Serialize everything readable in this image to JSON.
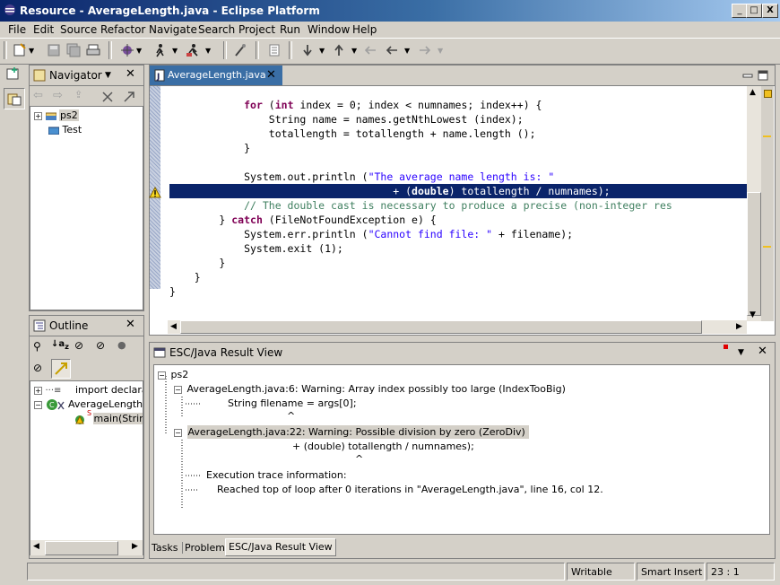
{
  "window": {
    "title": "Resource - AverageLength.java - Eclipse Platform",
    "controls": [
      "_",
      "□",
      "X"
    ]
  },
  "menu": [
    "File",
    "Edit",
    "Source",
    "Refactor",
    "Navigate",
    "Search",
    "Project",
    "Run",
    "Window",
    "Help"
  ],
  "navigator": {
    "title": "Navigator",
    "items": [
      "ps2",
      "Test"
    ]
  },
  "outline": {
    "title": "Outline",
    "items": [
      "import declarati",
      "AverageLength",
      "main(Strin"
    ],
    "static_marker": "S"
  },
  "editor": {
    "tab_label": "AverageLength.java",
    "lines": [
      [
        [
          "",
          "            "
        ],
        [
          "kw",
          "for"
        ],
        [
          "",
          " ("
        ],
        [
          "kw",
          "int"
        ],
        [
          "",
          " index = 0; index < numnames; index++) {"
        ]
      ],
      [
        [
          "",
          "                String name = names.getNthLowest (index);"
        ]
      ],
      [
        [
          "",
          "                totallength = totallength + name.length ();"
        ]
      ],
      [
        [
          "",
          "            }"
        ]
      ],
      [
        [
          "",
          ""
        ]
      ],
      [
        [
          "",
          "            System.out.println ("
        ],
        [
          "str",
          "\"The average name length is: \""
        ]
      ],
      [
        [
          "",
          "                                    + ("
        ],
        [
          "kw",
          "double"
        ],
        [
          "",
          ") totallength / numnames);"
        ]
      ],
      [
        [
          "",
          "            "
        ],
        [
          "cm",
          "// The double cast is necessary to produce a precise (non-integer res"
        ]
      ],
      [
        [
          "",
          "        } "
        ],
        [
          "kw",
          "catch"
        ],
        [
          "",
          " (FileNotFoundException e) {"
        ]
      ],
      [
        [
          "",
          "            System.err.println ("
        ],
        [
          "str",
          "\"Cannot find file: \""
        ],
        [
          "",
          " + filename);"
        ]
      ],
      [
        [
          "",
          "            System.exit (1);"
        ]
      ],
      [
        [
          "",
          "        }"
        ]
      ],
      [
        [
          "",
          "    }"
        ]
      ],
      [
        [
          "",
          "}"
        ]
      ]
    ],
    "selected_line": 6
  },
  "result_view": {
    "title": "ESC/Java Result View",
    "root": "ps2",
    "warning1": "AverageLength.java:6: Warning: Array index possibly too large (IndexTooBig)",
    "warning1_code": "String filename = args[0];",
    "warning1_caret": "^",
    "warning2": "AverageLength.java:22: Warning: Possible division by zero (ZeroDiv)",
    "warning2_code": "+ (double) totallength / numnames);",
    "warning2_caret": "^",
    "trace_header": "Execution trace information:",
    "trace_line": "Reached top of loop after 0 iterations in \"AverageLength.java\", line 16, col 12."
  },
  "bottom_tabs": [
    "Tasks",
    "Problems",
    "ESC/Java Result View"
  ],
  "status": {
    "writable": "Writable",
    "insert_mode": "Smart Insert",
    "position": "23 : 1"
  },
  "colors": {
    "title_gradient_start": "#0a246a",
    "selection": "#0a246a",
    "keyword": "#7f0055",
    "string": "#2a00ff",
    "comment": "#3f7f5f"
  }
}
